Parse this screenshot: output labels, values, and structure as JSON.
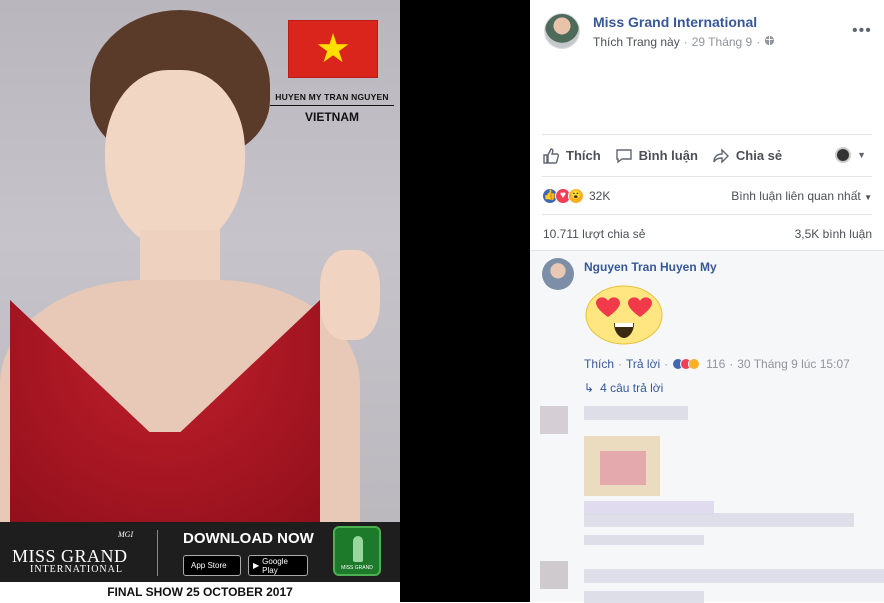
{
  "photo": {
    "contestant_name": "HUYEN MY TRAN  NGUYEN",
    "country": "VIETNAM",
    "banner": {
      "logo_line1": "MISS GRAND",
      "logo_line2": "INTERNATIONAL",
      "logo_badge": "MGI",
      "download": "DOWNLOAD NOW",
      "appstore": "App Store",
      "googleplay": "Google Play",
      "app_label": "MISS GRAND"
    },
    "final_show": "FINAL SHOW 25 OCTOBER 2017"
  },
  "post": {
    "page_name": "Miss Grand International",
    "like_page": "Thích Trang này",
    "dot": "·",
    "date": "29 Tháng 9",
    "more": "•••"
  },
  "actions": {
    "like": "Thích",
    "comment": "Bình luận",
    "share": "Chia sẻ"
  },
  "reactions": {
    "count": "32K",
    "sort_label": "Bình luận liên quan nhất"
  },
  "stats": {
    "shares": "10.711 lượt chia sẻ",
    "comments": "3,5K bình luận"
  },
  "comment": {
    "author": "Nguyen Tran Huyen My",
    "like": "Thích",
    "reply": "Trả lời",
    "reaction_count": "116",
    "timestamp": "30 Tháng 9 lúc 15:07",
    "replies": "4 câu trả lời",
    "sep": "·"
  },
  "colors": {
    "link": "#365899",
    "flag_red": "#da251d",
    "flag_star": "#ffde00"
  }
}
